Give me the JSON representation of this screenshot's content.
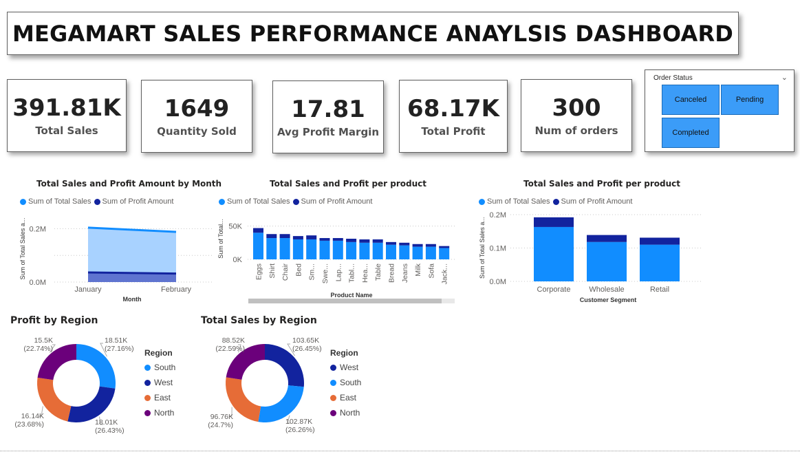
{
  "title": "MEGAMART SALES PERFORMANCE ANAYLSIS DASHBOARD",
  "kpis": {
    "total_sales": {
      "value": "391.81K",
      "label": "Total Sales"
    },
    "quantity_sold": {
      "value": "1649",
      "label": "Quantity Sold"
    },
    "avg_profit_margin": {
      "value": "17.81",
      "label": "Avg Profit Margin"
    },
    "total_profit": {
      "value": "68.17K",
      "label": "Total Profit"
    },
    "num_orders": {
      "value": "300",
      "label": "Num of orders"
    }
  },
  "slicer": {
    "title": "Order Status",
    "options": [
      "Canceled",
      "Pending",
      "Completed"
    ]
  },
  "colors": {
    "light_blue": "#118dff",
    "dark_blue": "#12239e",
    "area_fill": "#a8d2ff",
    "orange": "#e66c37",
    "purple": "#6b007b",
    "slicer_tile": "#3b9cf8"
  },
  "legend": {
    "sales": "Sum of Total Sales",
    "profit": "Sum of Profit Amount"
  },
  "chart_data": [
    {
      "id": "month",
      "type": "area",
      "title": "Total Sales and Profit Amount by Month",
      "xlabel": "Month",
      "ylabel": "Sum of Total Sales a...",
      "categories": [
        "January",
        "February"
      ],
      "series": [
        {
          "name": "Sum of Total Sales",
          "values": [
            204000,
            188000
          ]
        },
        {
          "name": "Sum of Profit Amount",
          "values": [
            36000,
            32000
          ]
        }
      ],
      "yticks": [
        "0.0M",
        "0.2M"
      ],
      "ylim": [
        0,
        250000
      ],
      "grid": true,
      "legend_position": "top-left"
    },
    {
      "id": "product",
      "type": "bar",
      "stacked": true,
      "title": "Total Sales and Profit per product",
      "xlabel": "Product Name",
      "ylabel": "Sum of Total...",
      "categories": [
        "Eggs",
        "Shirt",
        "Chair",
        "Bed",
        "Sm...",
        "Swe...",
        "Lap...",
        "Tabl...",
        "Hea...",
        "Table",
        "Bread",
        "Jeans",
        "Milk",
        "Sofa",
        "Jack..."
      ],
      "series": [
        {
          "name": "Sum of Total Sales",
          "values": [
            40000,
            32000,
            32000,
            30000,
            30000,
            28000,
            28000,
            26000,
            25000,
            25000,
            22000,
            21000,
            19000,
            19000,
            17000
          ]
        },
        {
          "name": "Sum of Profit Amount",
          "values": [
            7000,
            6000,
            6000,
            5000,
            6000,
            4000,
            4000,
            5000,
            5000,
            5000,
            4000,
            4000,
            4000,
            4000,
            3000
          ]
        }
      ],
      "yticks": [
        "0K",
        "50K"
      ],
      "ylim": [
        0,
        62000
      ],
      "grid": true,
      "legend_position": "top-left"
    },
    {
      "id": "segment",
      "type": "bar",
      "stacked": true,
      "title": "Total Sales and Profit per product",
      "xlabel": "Customer Segment",
      "ylabel": "Sum of Total Sales a...",
      "categories": [
        "Corporate",
        "Wholesale",
        "Retail"
      ],
      "series": [
        {
          "name": "Sum of Total Sales",
          "values": [
            163000,
            118000,
            110000
          ]
        },
        {
          "name": "Sum of Profit Amount",
          "values": [
            29000,
            21000,
            21000
          ]
        }
      ],
      "yticks": [
        "0.0M",
        "0.1M",
        "0.2M"
      ],
      "ylim": [
        0,
        200000
      ],
      "grid": true,
      "legend_position": "top-left"
    },
    {
      "id": "profit_region",
      "type": "pie",
      "donut": true,
      "title": "Profit by Region",
      "legend_title": "Region",
      "slices": [
        {
          "label": "South",
          "value": 18.51,
          "text": "18.51K",
          "pct": "(27.16%)",
          "color": "#118dff"
        },
        {
          "label": "West",
          "value": 18.01,
          "text": "18.01K",
          "pct": "(26.43%)",
          "color": "#12239e"
        },
        {
          "label": "East",
          "value": 16.14,
          "text": "16.14K",
          "pct": "(23.68%)",
          "color": "#e66c37"
        },
        {
          "label": "North",
          "value": 15.5,
          "text": "15.5K",
          "pct": "(22.74%)",
          "color": "#6b007b"
        }
      ]
    },
    {
      "id": "sales_region",
      "type": "pie",
      "donut": true,
      "title": "Total Sales by Region",
      "legend_title": "Region",
      "slices": [
        {
          "label": "West",
          "value": 103.65,
          "text": "103.65K",
          "pct": "(26.45%)",
          "color": "#12239e"
        },
        {
          "label": "South",
          "value": 102.87,
          "text": "102.87K",
          "pct": "(26.26%)",
          "color": "#118dff"
        },
        {
          "label": "East",
          "value": 96.76,
          "text": "96.76K",
          "pct": "(24.7%)",
          "color": "#e66c37"
        },
        {
          "label": "North",
          "value": 88.52,
          "text": "88.52K",
          "pct": "(22.59%)",
          "color": "#6b007b"
        }
      ]
    }
  ]
}
